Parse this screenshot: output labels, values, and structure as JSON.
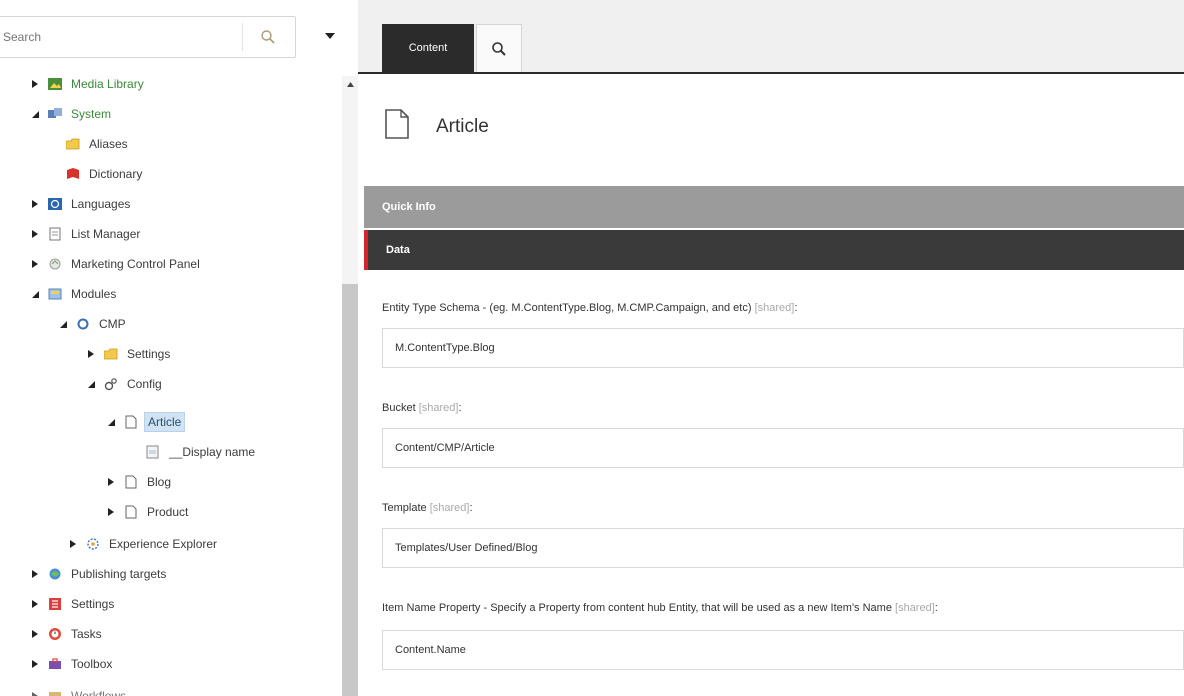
{
  "search": {
    "placeholder": "Search"
  },
  "tree": {
    "items": [
      {
        "label": "Media Library"
      },
      {
        "label": "System"
      },
      {
        "label": "Aliases"
      },
      {
        "label": "Dictionary"
      },
      {
        "label": "Languages"
      },
      {
        "label": "List Manager"
      },
      {
        "label": "Marketing Control Panel"
      },
      {
        "label": "Modules"
      },
      {
        "label": "CMP"
      },
      {
        "label": "Settings"
      },
      {
        "label": "Config"
      },
      {
        "label": "Article"
      },
      {
        "label": "__Display name"
      },
      {
        "label": "Blog"
      },
      {
        "label": "Product"
      },
      {
        "label": "Experience Explorer"
      },
      {
        "label": "Publishing targets"
      },
      {
        "label": "Settings"
      },
      {
        "label": "Tasks"
      },
      {
        "label": "Toolbox"
      },
      {
        "label": "Workflows"
      }
    ]
  },
  "tabs": {
    "content": "Content"
  },
  "item": {
    "title": "Article"
  },
  "sections": {
    "quick_info": "Quick Info",
    "data": "Data"
  },
  "fields": [
    {
      "label": "Entity Type Schema - (eg. M.ContentType.Blog, M.CMP.Campaign, and etc)",
      "shared": "[shared]",
      "suffix": ":",
      "value": "M.ContentType.Blog"
    },
    {
      "label": "Bucket",
      "shared": "[shared]",
      "suffix": ":",
      "value": "Content/CMP/Article"
    },
    {
      "label": "Template",
      "shared": "[shared]",
      "suffix": ":",
      "value": "Templates/User Defined/Blog"
    },
    {
      "label": "Item Name Property - Specify a Property from content hub Entity, that will be used as a new Item's Name",
      "shared": "[shared]",
      "suffix": ":",
      "value": "Content.Name"
    }
  ],
  "colors": {
    "accent": "#d9242b",
    "dark_bar": "#3a3a3a",
    "grey_bar": "#9b9b9b",
    "selection": "#cfe3f3",
    "green_text": "#3a8a3a"
  },
  "icons": [
    "search-icon",
    "caret-down-icon",
    "media-library-icon",
    "system-icon",
    "aliases-folder-icon",
    "dictionary-icon",
    "languages-icon",
    "list-manager-icon",
    "marketing-control-panel-icon",
    "modules-icon",
    "cmp-icon",
    "settings-folder-icon",
    "config-icon",
    "document-icon",
    "display-name-field-icon",
    "experience-explorer-icon",
    "publishing-targets-icon",
    "settings-icon",
    "tasks-icon",
    "toolbox-icon",
    "workflows-icon"
  ]
}
